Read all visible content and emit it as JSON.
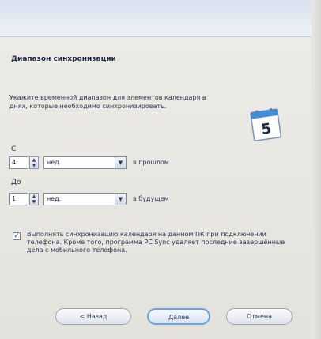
{
  "dialog": {
    "title": "Диапазон синхронизации",
    "description": "Укажите временной диапазон для элементов календаря в днях, которые необходимо синхронизировать."
  },
  "from": {
    "label": "С",
    "number": "4",
    "unit": "нед.",
    "suffix": "в прошлом"
  },
  "to": {
    "label": "До",
    "number": "1",
    "unit": "нед.",
    "suffix": "в будущем"
  },
  "option": {
    "checked": true,
    "text": "Выполнять синхронизацию календаря на данном ПК при подключении телефона. Кроме того, программа PC Sync удаляет последние завершённые дела с мобильного телефона."
  },
  "icons": {
    "calendar": "calendar-icon",
    "calendar_day": "5"
  },
  "buttons": {
    "back": "< Назад",
    "next": "Далее",
    "cancel": "Отмена"
  },
  "colors": {
    "accent": "#6aa3e0",
    "title": "#1e2a4a"
  }
}
